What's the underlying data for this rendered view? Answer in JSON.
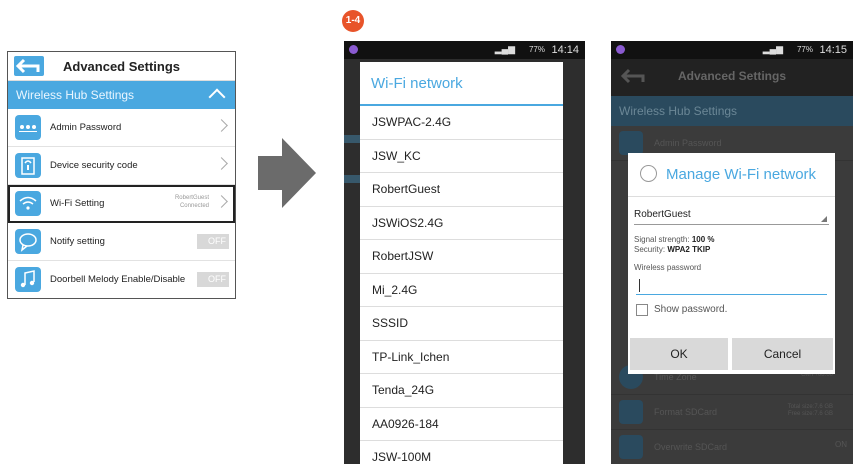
{
  "panel1": {
    "title": "Advanced Settings",
    "section": "Wireless Hub Settings",
    "rows": [
      {
        "label": "Admin Password",
        "icon": "password-dots-icon"
      },
      {
        "label": "Device security code",
        "icon": "lock-icon"
      },
      {
        "label": "Wi-Fi Setting",
        "icon": "wifi-icon",
        "sub1": "RobertGuest",
        "sub2": "Connected"
      },
      {
        "label": "Notify setting",
        "icon": "chat-bubble-icon",
        "toggle": "OFF"
      },
      {
        "label": "Doorbell Melody Enable/Disable",
        "icon": "music-note-icon",
        "toggle": "OFF"
      }
    ]
  },
  "step_badge": "1-4",
  "status": {
    "battery": "77%",
    "time2": "14:14",
    "time3": "14:15"
  },
  "wifi_list": {
    "title": "Wi-Fi network",
    "networks": [
      "JSWPAC-2.4G",
      "JSW_KC",
      "RobertGuest",
      "JSWiOS2.4G",
      "RobertJSW",
      "Mi_2.4G",
      "SSSID",
      "TP-Link_Ichen",
      "Tenda_24G",
      "AA0926-184",
      "JSW-100M"
    ]
  },
  "phone3": {
    "header": "Advanced Settings",
    "section": "Wireless Hub Settings",
    "bg_rows": [
      "Admin Password",
      "Time Zone",
      "Format SDCard",
      "Overwrite SDCard"
    ],
    "format_sub1": "Total size:7.6 GB",
    "format_sub2": "Free size:7.6 GB",
    "timezone_sub": "GMT+08:00",
    "overwrite_toggle": "ON"
  },
  "manage_dialog": {
    "title": "Manage Wi-Fi network",
    "ssid": "RobertGuest",
    "signal_label": "Signal strength:",
    "signal_value": "100 %",
    "security_label": "Security:",
    "security_value": "WPA2 TKIP",
    "password_label": "Wireless password",
    "show_password": "Show password.",
    "ok": "OK",
    "cancel": "Cancel"
  },
  "colors": {
    "accent": "#4aa8e0",
    "badge": "#e8542a"
  }
}
